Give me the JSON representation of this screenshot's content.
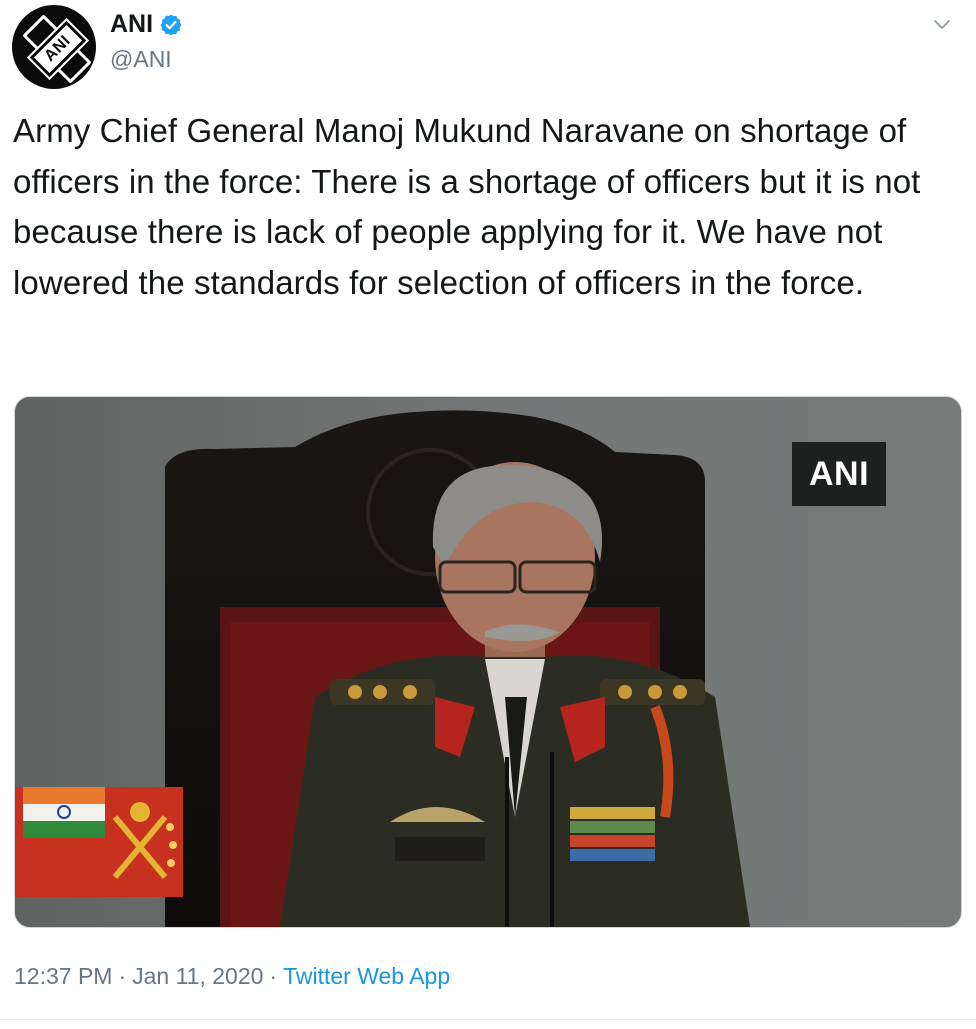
{
  "tweet": {
    "author": {
      "display_name": "ANI",
      "handle": "@ANI",
      "verified": true,
      "avatar_text": "ANI"
    },
    "text": "Army Chief General Manoj Mukund Naravane on shortage of officers in the force: There is a shortage of officers but it is not because there is lack of people applying for it. We have not lowered the standards for selection of officers in the force.",
    "media": {
      "watermark": "ANI"
    },
    "time": "12:37 PM",
    "separator": "·",
    "date": "Jan 11, 2020",
    "source": "Twitter Web App"
  },
  "icons": {
    "verified": "verified-badge-icon",
    "caret": "chevron-down-icon"
  },
  "colors": {
    "text": "#14171a",
    "secondary": "#657786",
    "link": "#1b95e0",
    "verified": "#1da1f2"
  }
}
